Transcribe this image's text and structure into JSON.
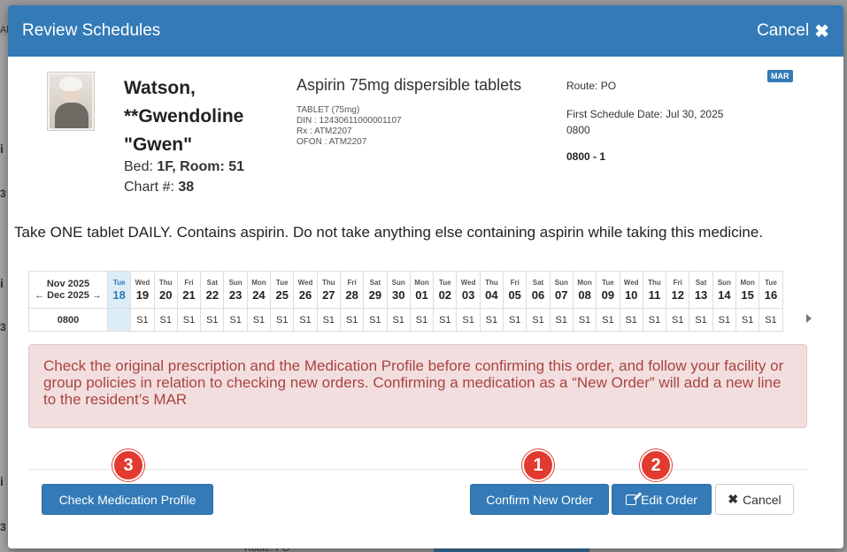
{
  "background": {
    "fragments": [
      "Al",
      "i",
      "3",
      "i",
      "3",
      "i",
      "3",
      "Route: PO",
      "C"
    ]
  },
  "modal": {
    "title": "Review Schedules",
    "cancel_label": "Cancel",
    "cancel_icon": "close-icon"
  },
  "patient": {
    "name_line1": "Watson,",
    "name_line2": "**Gwendoline",
    "name_line3": "\"Gwen\"",
    "bed_label": "Bed: ",
    "bed_value": "1F, Room: 51",
    "chart_label": "Chart #: ",
    "chart_value": "38"
  },
  "medication": {
    "name": "Aspirin 75mg dispersible tablets",
    "form": "TABLET (75mg)",
    "din": "DIN : 12430611000001107",
    "rx": "Rx : ATM2207",
    "ofon": "OFON : ATM2207",
    "route": "Route: PO",
    "first_schedule_date": "First Schedule Date: Jul 30, 2025",
    "first_schedule_time": "0800",
    "schedule": "0800 - 1",
    "badge": "MAR"
  },
  "instructions": "Take ONE tablet DAILY. Contains aspirin. Do not take anything else containing aspirin while taking this medicine.",
  "calendar": {
    "month_current": "Nov 2025",
    "month_nav": "← Dec 2025 →",
    "time": "0800",
    "days": [
      {
        "dow": "Tue",
        "day": "18",
        "slot": ""
      },
      {
        "dow": "Wed",
        "day": "19",
        "slot": "S1"
      },
      {
        "dow": "Thu",
        "day": "20",
        "slot": "S1"
      },
      {
        "dow": "Fri",
        "day": "21",
        "slot": "S1"
      },
      {
        "dow": "Sat",
        "day": "22",
        "slot": "S1"
      },
      {
        "dow": "Sun",
        "day": "23",
        "slot": "S1"
      },
      {
        "dow": "Mon",
        "day": "24",
        "slot": "S1"
      },
      {
        "dow": "Tue",
        "day": "25",
        "slot": "S1"
      },
      {
        "dow": "Wed",
        "day": "26",
        "slot": "S1"
      },
      {
        "dow": "Thu",
        "day": "27",
        "slot": "S1"
      },
      {
        "dow": "Fri",
        "day": "28",
        "slot": "S1"
      },
      {
        "dow": "Sat",
        "day": "29",
        "slot": "S1"
      },
      {
        "dow": "Sun",
        "day": "30",
        "slot": "S1"
      },
      {
        "dow": "Mon",
        "day": "01",
        "slot": "S1"
      },
      {
        "dow": "Tue",
        "day": "02",
        "slot": "S1"
      },
      {
        "dow": "Wed",
        "day": "03",
        "slot": "S1"
      },
      {
        "dow": "Thu",
        "day": "04",
        "slot": "S1"
      },
      {
        "dow": "Fri",
        "day": "05",
        "slot": "S1"
      },
      {
        "dow": "Sat",
        "day": "06",
        "slot": "S1"
      },
      {
        "dow": "Sun",
        "day": "07",
        "slot": "S1"
      },
      {
        "dow": "Mon",
        "day": "08",
        "slot": "S1"
      },
      {
        "dow": "Tue",
        "day": "09",
        "slot": "S1"
      },
      {
        "dow": "Wed",
        "day": "10",
        "slot": "S1"
      },
      {
        "dow": "Thu",
        "day": "11",
        "slot": "S1"
      },
      {
        "dow": "Fri",
        "day": "12",
        "slot": "S1"
      },
      {
        "dow": "Sat",
        "day": "13",
        "slot": "S1"
      },
      {
        "dow": "Sun",
        "day": "14",
        "slot": "S1"
      },
      {
        "dow": "Mon",
        "day": "15",
        "slot": "S1"
      },
      {
        "dow": "Tue",
        "day": "16",
        "slot": "S1"
      }
    ]
  },
  "alert": "Check the original prescription and the Medication Profile before confirming this order, and follow your facility or group policies in relation to checking new orders. Confirming a medication as a “New Order” will add a new line to the resident’s MAR",
  "buttons": {
    "check_profile": "Check Medication Profile",
    "confirm_new": "Confirm New Order",
    "edit_order": "Edit Order",
    "cancel": "Cancel"
  },
  "callouts": {
    "one": "1",
    "two": "2",
    "three": "3"
  },
  "colors": {
    "primary": "#337ab7",
    "alert_bg": "#f2dede",
    "alert_text": "#a94442",
    "callout": "#e23a2f"
  }
}
